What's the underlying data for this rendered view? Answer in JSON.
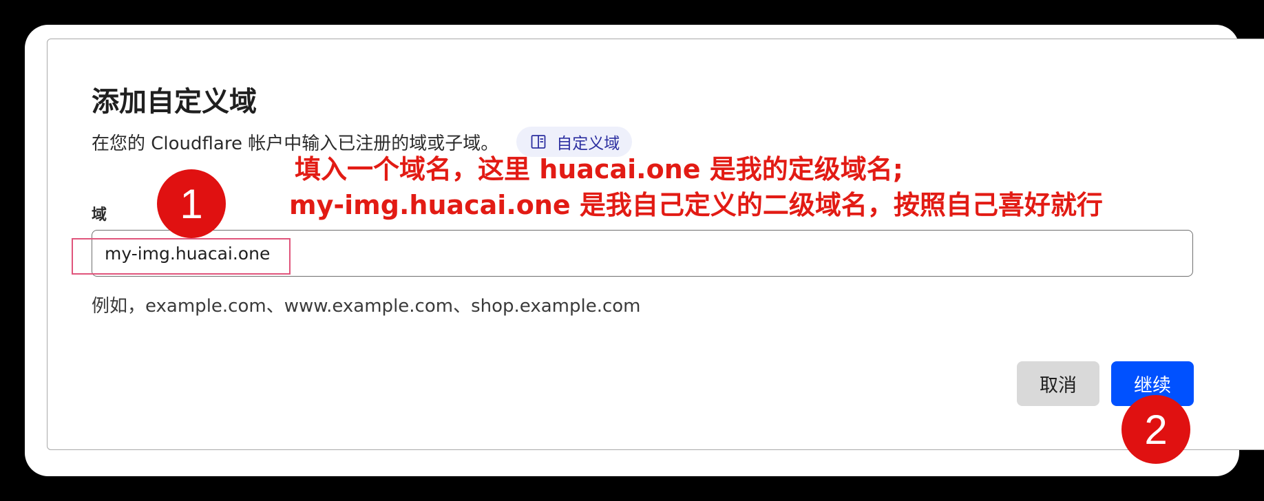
{
  "dialog": {
    "title": "添加自定义域",
    "subtitle": "在您的 Cloudflare 帐户中输入已注册的域或子域。",
    "doc_link": {
      "icon": "book-icon",
      "label": "自定义域"
    },
    "field": {
      "label": "域",
      "value": "my-img.huacai.one",
      "hint": "例如，example.com、www.example.com、shop.example.com"
    },
    "buttons": {
      "cancel_label": "取消",
      "continue_label": "继续"
    }
  },
  "annotations": {
    "line1": "填入一个域名，这里 huacai.one 是我的定级域名;",
    "line2": "my-img.huacai.one 是我自己定义的二级域名，按照自己喜好就行",
    "badge1": "1",
    "badge2": "2",
    "color": "#e21b14"
  },
  "colors": {
    "primary_button": "#0051ff",
    "cancel_button": "#d9d9d9",
    "doc_chip_bg": "#eef0fb",
    "doc_chip_text": "#2c2fa0",
    "highlight_border": "#e0547b"
  }
}
